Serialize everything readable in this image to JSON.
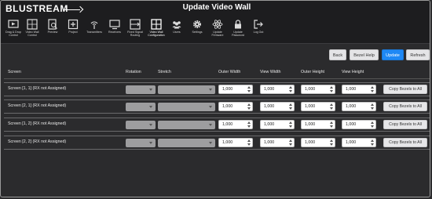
{
  "header": {
    "logo": "BLUSTREAM",
    "title": "Update Video Wall"
  },
  "nav": {
    "items": [
      {
        "label": "Drag & Drop Control",
        "icon": "play-screen-icon"
      },
      {
        "label": "Video Wall Control",
        "icon": "grid-play-icon"
      },
      {
        "label": "Preview",
        "icon": "document-search-icon"
      },
      {
        "label": "Project",
        "icon": "plus-box-icon"
      },
      {
        "label": "Transmitters",
        "icon": "antenna-icon"
      },
      {
        "label": "Receivers",
        "icon": "monitor-icon"
      },
      {
        "label": "Fixed Signal Routing",
        "icon": "routing-icon"
      },
      {
        "label": "Video Wall Configuration",
        "icon": "video-wall-icon"
      },
      {
        "label": "Users",
        "icon": "users-icon"
      },
      {
        "label": "Settings",
        "icon": "gear-icon"
      },
      {
        "label": "Update Firmware",
        "icon": "atom-icon"
      },
      {
        "label": "Update Password",
        "icon": "lock-icon"
      },
      {
        "label": "Log Out",
        "icon": "logout-icon"
      }
    ]
  },
  "toolbar": {
    "back": "Back",
    "bezel_help": "Bezel Help",
    "update": "Update",
    "refresh": "Refresh"
  },
  "table": {
    "headers": {
      "screen": "Screen",
      "rotation": "Rotation",
      "stretch": "Stretch",
      "outer_width": "Outer Width",
      "view_width": "View Width",
      "outer_height": "Outer Height",
      "view_height": "View Height"
    },
    "rows": [
      {
        "screen": "Screen [1, 1] (RX not Assigned)",
        "outer_width": "1,000",
        "view_width": "1,000",
        "outer_height": "1,000",
        "view_height": "1,000",
        "copy": "Copy Bezels to All"
      },
      {
        "screen": "Screen [2, 1] (RX not Assigned)",
        "outer_width": "1,000",
        "view_width": "1,000",
        "outer_height": "1,000",
        "view_height": "1,000",
        "copy": "Copy Bezels to All"
      },
      {
        "screen": "Screen [1, 2] (RX not Assigned)",
        "outer_width": "1,000",
        "view_width": "1,000",
        "outer_height": "1,000",
        "view_height": "1,000",
        "copy": "Copy Bezels to All"
      },
      {
        "screen": "Screen [2, 2] (RX not Assigned)",
        "outer_width": "1,000",
        "view_width": "1,000",
        "outer_height": "1,000",
        "view_height": "1,000",
        "copy": "Copy Bezels to All"
      }
    ]
  },
  "colors": {
    "background": "#2b2b2d",
    "header": "#1d1d1f",
    "primary": "#1e88f5"
  }
}
